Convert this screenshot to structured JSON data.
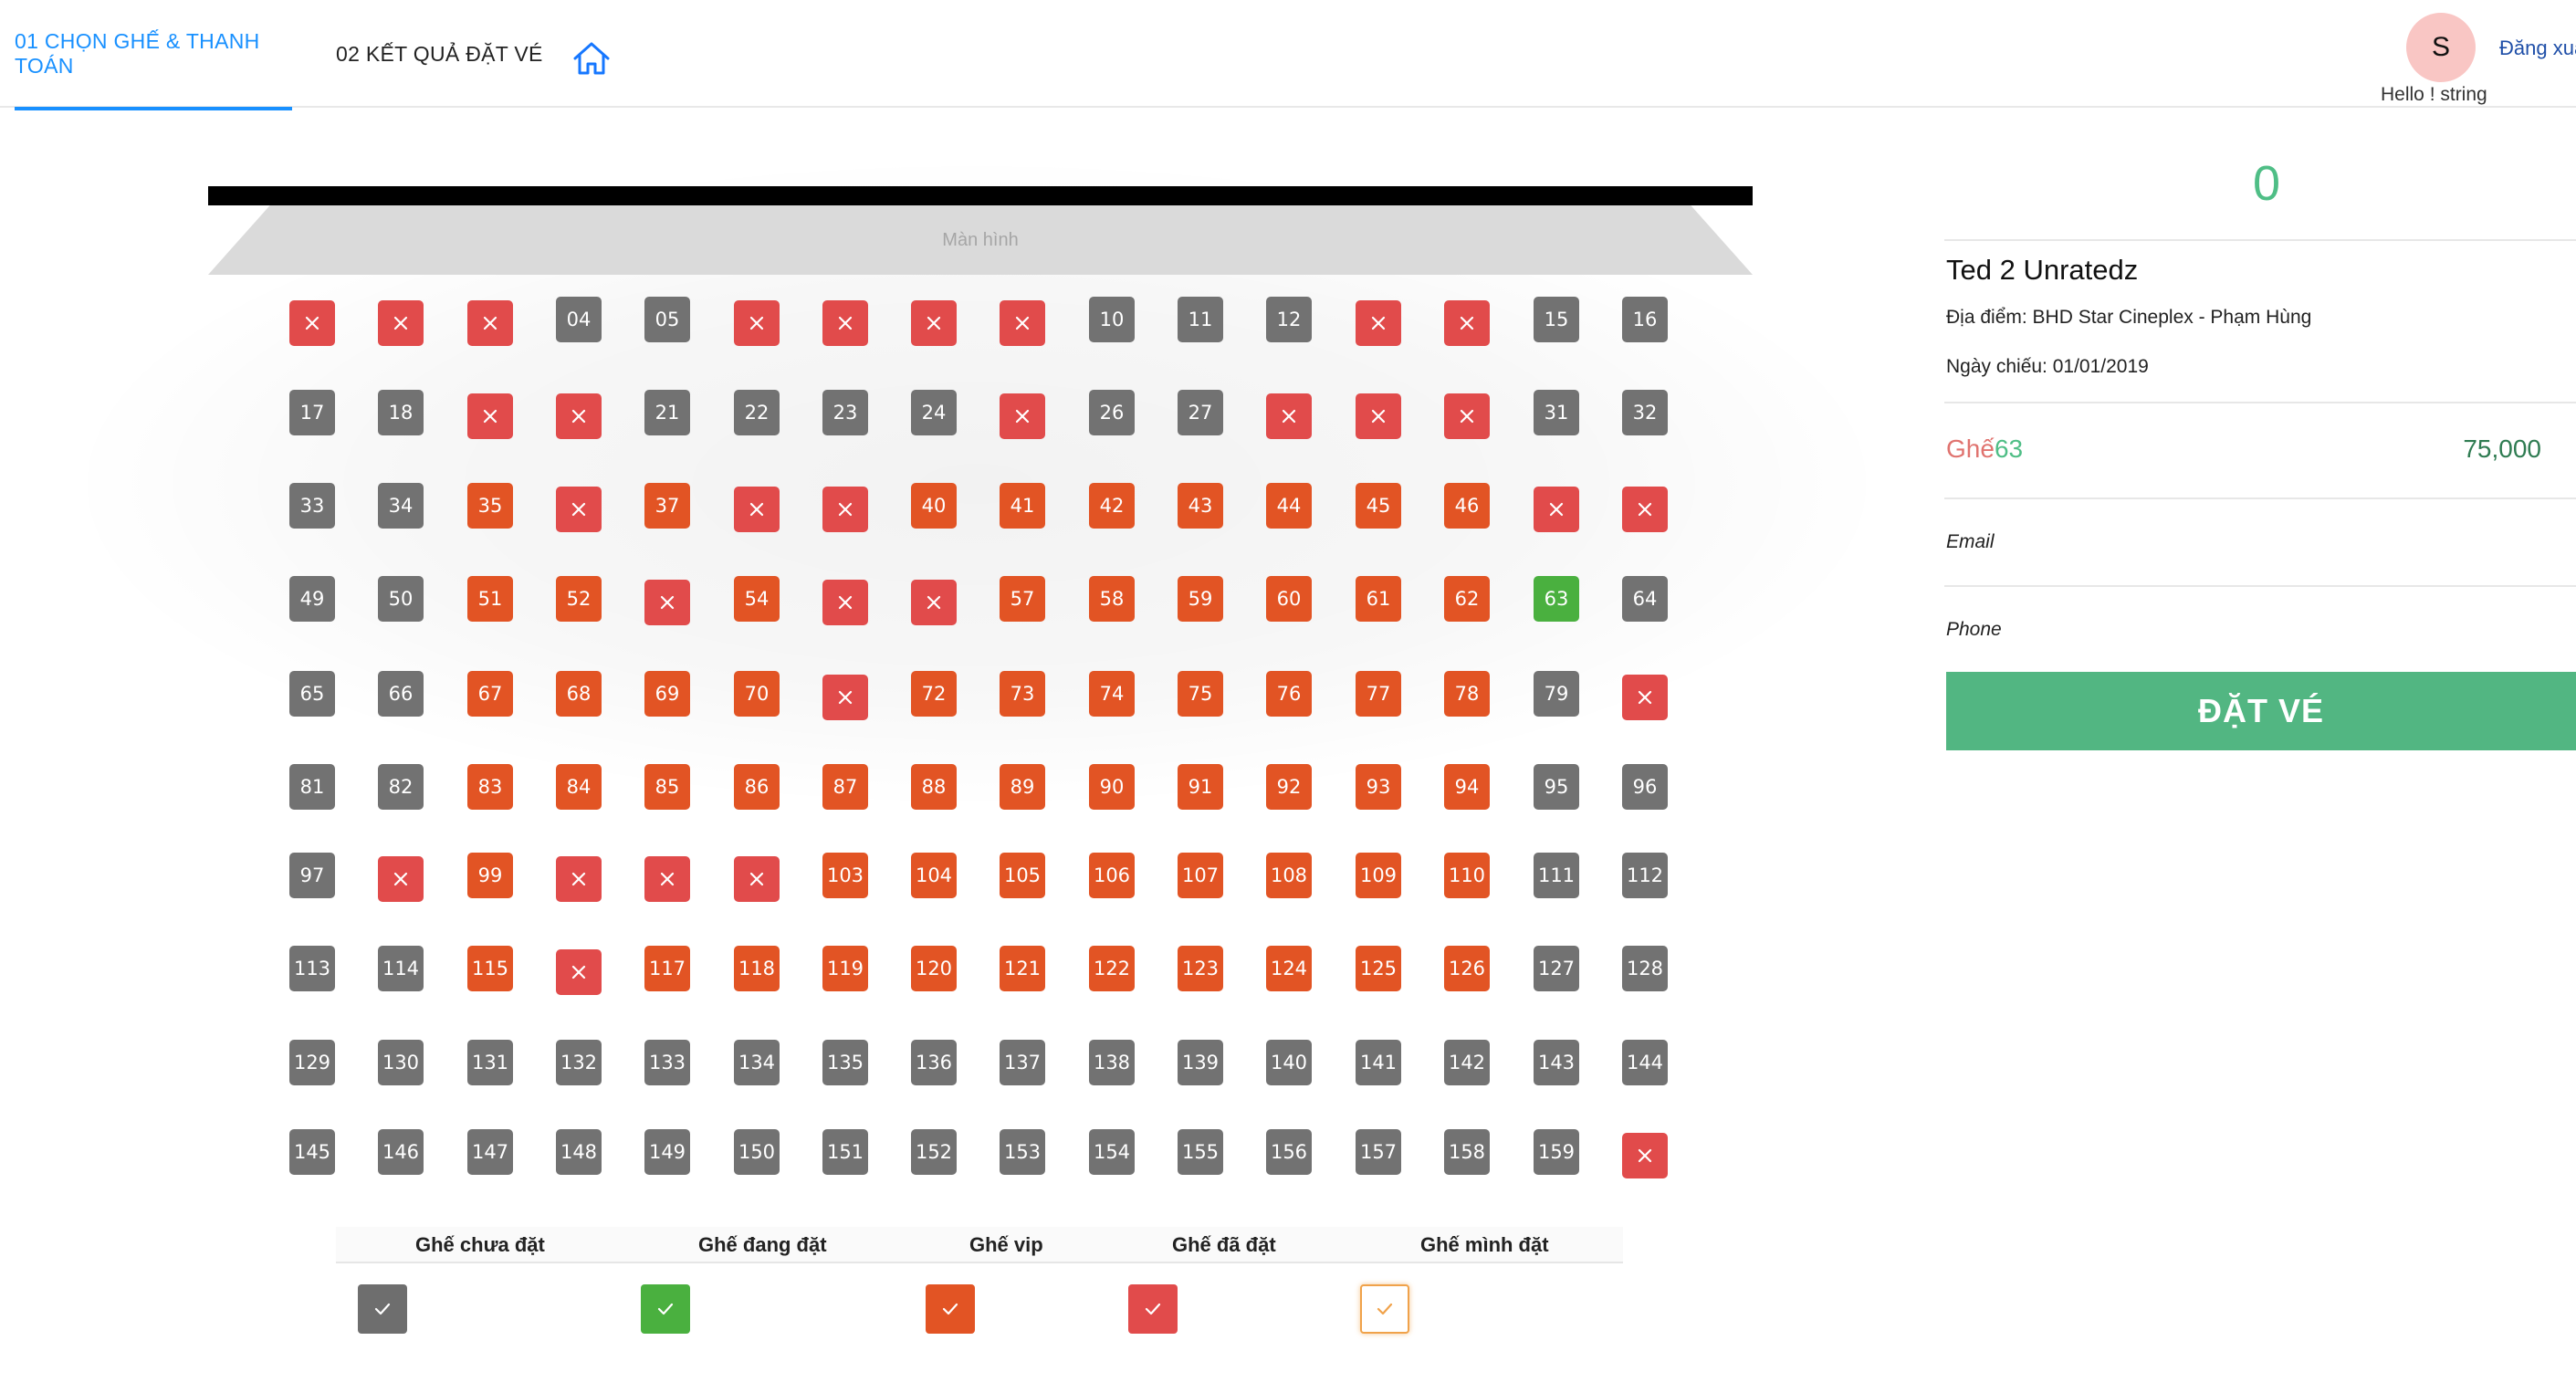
{
  "tabs": [
    {
      "label": "01 CHỌN GHẾ & THANH TOÁN",
      "active": true
    },
    {
      "label": "02 KẾT QUẢ ĐẶT VÉ",
      "active": false
    }
  ],
  "home_icon": "home-icon",
  "user": {
    "avatar_letter": "S",
    "logout_label": "Đăng xuất",
    "greeting": "Hello ! string"
  },
  "screen": {
    "label": "Màn hình"
  },
  "seat_kinds": {
    "gray": "#727272",
    "vip": "#e25424",
    "taken": "#e14b4b",
    "mine": "#4ab03f"
  },
  "seat_rows": [
    [
      [
        "x",
        "taken"
      ],
      [
        "x",
        "taken"
      ],
      [
        "x",
        "taken"
      ],
      [
        "04",
        "gray"
      ],
      [
        "05",
        "gray"
      ],
      [
        "x",
        "taken"
      ],
      [
        "x",
        "taken"
      ],
      [
        "x",
        "taken"
      ],
      [
        "x",
        "taken"
      ],
      [
        "10",
        "gray"
      ],
      [
        "11",
        "gray"
      ],
      [
        "12",
        "gray"
      ],
      [
        "x",
        "taken"
      ],
      [
        "x",
        "taken"
      ],
      [
        "15",
        "gray"
      ],
      [
        "16",
        "gray"
      ]
    ],
    [
      [
        "17",
        "gray"
      ],
      [
        "18",
        "gray"
      ],
      [
        "x",
        "taken"
      ],
      [
        "x",
        "taken"
      ],
      [
        "21",
        "gray"
      ],
      [
        "22",
        "gray"
      ],
      [
        "23",
        "gray"
      ],
      [
        "24",
        "gray"
      ],
      [
        "x",
        "taken"
      ],
      [
        "26",
        "gray"
      ],
      [
        "27",
        "gray"
      ],
      [
        "x",
        "taken"
      ],
      [
        "x",
        "taken"
      ],
      [
        "x",
        "taken"
      ],
      [
        "31",
        "gray"
      ],
      [
        "32",
        "gray"
      ]
    ],
    [
      [
        "33",
        "gray"
      ],
      [
        "34",
        "gray"
      ],
      [
        "35",
        "vip"
      ],
      [
        "x",
        "taken"
      ],
      [
        "37",
        "vip"
      ],
      [
        "x",
        "taken"
      ],
      [
        "x",
        "taken"
      ],
      [
        "40",
        "vip"
      ],
      [
        "41",
        "vip"
      ],
      [
        "42",
        "vip"
      ],
      [
        "43",
        "vip"
      ],
      [
        "44",
        "vip"
      ],
      [
        "45",
        "vip"
      ],
      [
        "46",
        "vip"
      ],
      [
        "x",
        "taken"
      ],
      [
        "x",
        "taken"
      ]
    ],
    [
      [
        "49",
        "gray"
      ],
      [
        "50",
        "gray"
      ],
      [
        "51",
        "vip"
      ],
      [
        "52",
        "vip"
      ],
      [
        "x",
        "taken"
      ],
      [
        "54",
        "vip"
      ],
      [
        "x",
        "taken"
      ],
      [
        "x",
        "taken"
      ],
      [
        "57",
        "vip"
      ],
      [
        "58",
        "vip"
      ],
      [
        "59",
        "vip"
      ],
      [
        "60",
        "vip"
      ],
      [
        "61",
        "vip"
      ],
      [
        "62",
        "vip"
      ],
      [
        "63",
        "mine"
      ],
      [
        "64",
        "gray"
      ]
    ],
    [
      [
        "65",
        "gray"
      ],
      [
        "66",
        "gray"
      ],
      [
        "67",
        "vip"
      ],
      [
        "68",
        "vip"
      ],
      [
        "69",
        "vip"
      ],
      [
        "70",
        "vip"
      ],
      [
        "x",
        "taken"
      ],
      [
        "72",
        "vip"
      ],
      [
        "73",
        "vip"
      ],
      [
        "74",
        "vip"
      ],
      [
        "75",
        "vip"
      ],
      [
        "76",
        "vip"
      ],
      [
        "77",
        "vip"
      ],
      [
        "78",
        "vip"
      ],
      [
        "79",
        "gray"
      ],
      [
        "x",
        "taken"
      ]
    ],
    [
      [
        "81",
        "gray"
      ],
      [
        "82",
        "gray"
      ],
      [
        "83",
        "vip"
      ],
      [
        "84",
        "vip"
      ],
      [
        "85",
        "vip"
      ],
      [
        "86",
        "vip"
      ],
      [
        "87",
        "vip"
      ],
      [
        "88",
        "vip"
      ],
      [
        "89",
        "vip"
      ],
      [
        "90",
        "vip"
      ],
      [
        "91",
        "vip"
      ],
      [
        "92",
        "vip"
      ],
      [
        "93",
        "vip"
      ],
      [
        "94",
        "vip"
      ],
      [
        "95",
        "gray"
      ],
      [
        "96",
        "gray"
      ]
    ],
    [
      [
        "97",
        "gray"
      ],
      [
        "x",
        "taken"
      ],
      [
        "99",
        "vip"
      ],
      [
        "x",
        "taken"
      ],
      [
        "x",
        "taken"
      ],
      [
        "x",
        "taken"
      ],
      [
        "103",
        "vip"
      ],
      [
        "104",
        "vip"
      ],
      [
        "105",
        "vip"
      ],
      [
        "106",
        "vip"
      ],
      [
        "107",
        "vip"
      ],
      [
        "108",
        "vip"
      ],
      [
        "109",
        "vip"
      ],
      [
        "110",
        "vip"
      ],
      [
        "111",
        "gray"
      ],
      [
        "112",
        "gray"
      ]
    ],
    [
      [
        "113",
        "gray"
      ],
      [
        "114",
        "gray"
      ],
      [
        "115",
        "vip"
      ],
      [
        "x",
        "taken"
      ],
      [
        "117",
        "vip"
      ],
      [
        "118",
        "vip"
      ],
      [
        "119",
        "vip"
      ],
      [
        "120",
        "vip"
      ],
      [
        "121",
        "vip"
      ],
      [
        "122",
        "vip"
      ],
      [
        "123",
        "vip"
      ],
      [
        "124",
        "vip"
      ],
      [
        "125",
        "vip"
      ],
      [
        "126",
        "vip"
      ],
      [
        "127",
        "gray"
      ],
      [
        "128",
        "gray"
      ]
    ],
    [
      [
        "129",
        "gray"
      ],
      [
        "130",
        "gray"
      ],
      [
        "131",
        "gray"
      ],
      [
        "132",
        "gray"
      ],
      [
        "133",
        "gray"
      ],
      [
        "134",
        "gray"
      ],
      [
        "135",
        "gray"
      ],
      [
        "136",
        "gray"
      ],
      [
        "137",
        "gray"
      ],
      [
        "138",
        "gray"
      ],
      [
        "139",
        "gray"
      ],
      [
        "140",
        "gray"
      ],
      [
        "141",
        "gray"
      ],
      [
        "142",
        "gray"
      ],
      [
        "143",
        "gray"
      ],
      [
        "144",
        "gray"
      ]
    ],
    [
      [
        "145",
        "gray"
      ],
      [
        "146",
        "gray"
      ],
      [
        "147",
        "gray"
      ],
      [
        "148",
        "gray"
      ],
      [
        "149",
        "gray"
      ],
      [
        "150",
        "gray"
      ],
      [
        "151",
        "gray"
      ],
      [
        "152",
        "gray"
      ],
      [
        "153",
        "gray"
      ],
      [
        "154",
        "gray"
      ],
      [
        "155",
        "gray"
      ],
      [
        "156",
        "gray"
      ],
      [
        "157",
        "gray"
      ],
      [
        "158",
        "gray"
      ],
      [
        "159",
        "gray"
      ],
      [
        "x",
        "taken"
      ]
    ]
  ],
  "legend": [
    {
      "label": "Ghế chưa đặt",
      "style": "gray",
      "icon": "check-icon"
    },
    {
      "label": "Ghế đang đặt",
      "style": "mine",
      "icon": "check-icon"
    },
    {
      "label": "Ghế vip",
      "style": "vip",
      "icon": "check-icon"
    },
    {
      "label": "Ghế đã đặt",
      "style": "taken",
      "icon": "check-icon"
    },
    {
      "label": "Ghế mình đặt",
      "style": "outline",
      "icon": "check-icon"
    }
  ],
  "booking": {
    "total": "0",
    "movie_title": "Ted 2 Unratedz",
    "location": "Địa điểm: BHD Star Cineplex - Phạm Hùng",
    "date": "Ngày chiếu: 01/01/2019",
    "seat_prefix": "Ghế",
    "seat_number": "63",
    "price": "75,000",
    "email_label": "Email",
    "phone_label": "Phone",
    "book_button": "ĐẶT VÉ"
  }
}
